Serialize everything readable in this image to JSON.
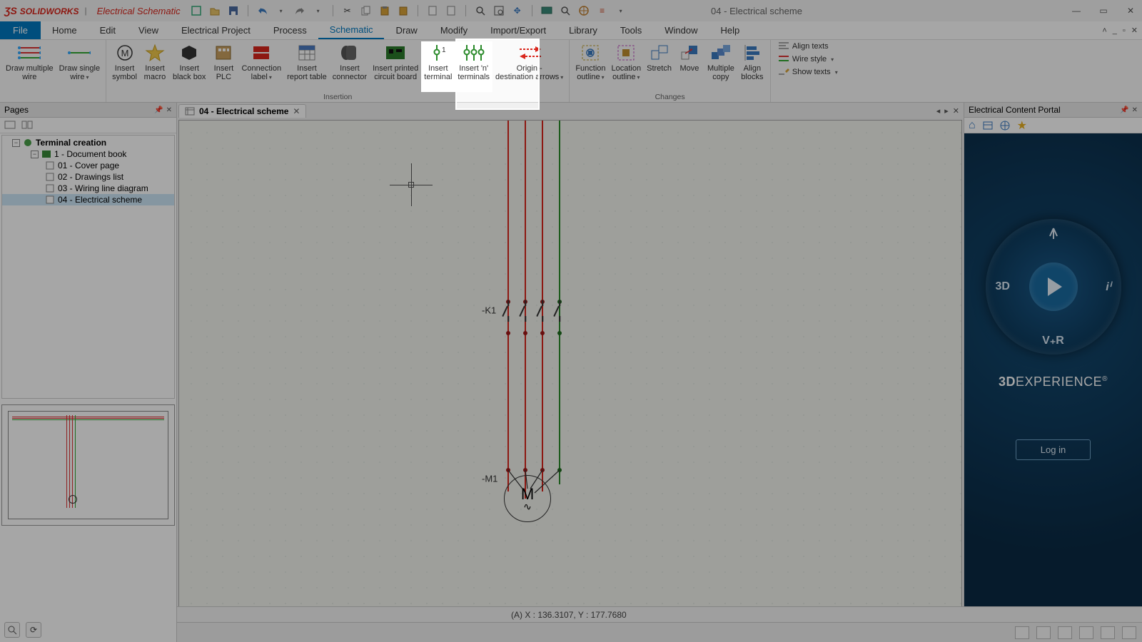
{
  "title": {
    "brand_a": "S",
    "brand_b": "SOLID",
    "brand_c": "WORKS",
    "subtitle": "Electrical Schematic",
    "doc": "04 - Electrical scheme"
  },
  "win": {
    "min": "—",
    "max": "▭",
    "close": "✕"
  },
  "menu": {
    "file": "File",
    "tabs": [
      "Home",
      "Edit",
      "View",
      "Electrical Project",
      "Process",
      "Schematic",
      "Draw",
      "Modify",
      "Import/Export",
      "Library",
      "Tools",
      "Window",
      "Help"
    ],
    "active": "Schematic",
    "chevup": "˄",
    "mini": "_",
    "rest": "▫",
    "x": "✕"
  },
  "ribbon": {
    "wires": {
      "multi": "Draw multiple\nwire",
      "single": "Draw single\nwire"
    },
    "insertion_label": "Insertion",
    "insertion": {
      "symbol": "Insert\nsymbol",
      "macro": "Insert\nmacro",
      "blackbox": "Insert\nblack box",
      "plc": "Insert\nPLC",
      "connlabel": "Connection\nlabel",
      "report": "Insert\nreport table",
      "connector": "Insert\nconnector",
      "pcb": "Insert printed\ncircuit board",
      "terminal": "Insert\nterminal",
      "nterm": "Insert 'n'\nterminals",
      "origdest": "Origin -\ndestination arrows"
    },
    "changes_label": "Changes",
    "changes": {
      "foutline": "Function\noutline",
      "loutline": "Location\noutline",
      "stretch": "Stretch",
      "move": "Move",
      "mcopy": "Multiple\ncopy",
      "ablocks": "Align\nblocks"
    },
    "stack": {
      "align": "Align texts",
      "wstyle": "Wire style",
      "showt": "Show texts"
    }
  },
  "pages": {
    "title": "Pages",
    "root": "Terminal creation",
    "book": "1 - Document book",
    "items": [
      "01 - Cover page",
      "02 - Drawings list",
      "03 - Wiring line diagram",
      "04 - Electrical scheme"
    ]
  },
  "doctab": {
    "icon": "▦",
    "label": "04 - Electrical scheme",
    "close": "✕"
  },
  "schem": {
    "k1": "-K1",
    "m1": "-M1",
    "motor_letter": "M",
    "motor_sine": "∿"
  },
  "status": {
    "coord": "(A) X : 136.3107, Y : 177.7680"
  },
  "portal": {
    "title": "Electrical Content Portal",
    "n_icon": "⅄",
    "w": "3D",
    "e": "iⁱ",
    "s": "V₊R",
    "logo_a": "3D",
    "logo_b": "EXPERIENCE",
    "logo_r": "®",
    "login": "Log in"
  }
}
